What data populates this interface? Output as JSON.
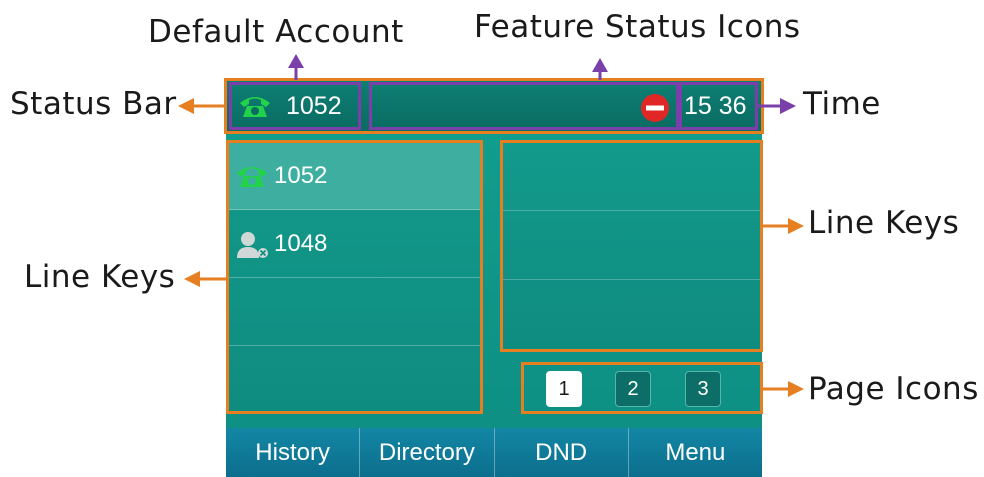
{
  "annotations": {
    "default_account": "Default Account",
    "feature_status_icons": "Feature Status Icons",
    "status_bar": "Status Bar",
    "time": "Time",
    "line_keys_left": "Line Keys",
    "line_keys_right": "Line Keys",
    "page_icons": "Page Icons"
  },
  "status_bar": {
    "account": "1052",
    "time": "15 36",
    "status_icon": "dnd-icon"
  },
  "line_keys": [
    {
      "label": "1052",
      "icon": "phone-icon",
      "active": true
    },
    {
      "label": "1048",
      "icon": "contact-icon",
      "active": false
    },
    {
      "label": "",
      "icon": "",
      "active": false
    },
    {
      "label": "",
      "icon": "",
      "active": false
    }
  ],
  "pages": [
    "1",
    "2",
    "3"
  ],
  "current_page": "1",
  "softkeys": [
    "History",
    "Directory",
    "DND",
    "Menu"
  ],
  "colors": {
    "annotation_orange": "#e67e22",
    "annotation_purple": "#7a3fa8",
    "screen_teal": "#0f9486",
    "softkey_blue": "#0c6e8d",
    "phone_icon_green": "#22d34a",
    "dnd_red": "#e12626"
  }
}
